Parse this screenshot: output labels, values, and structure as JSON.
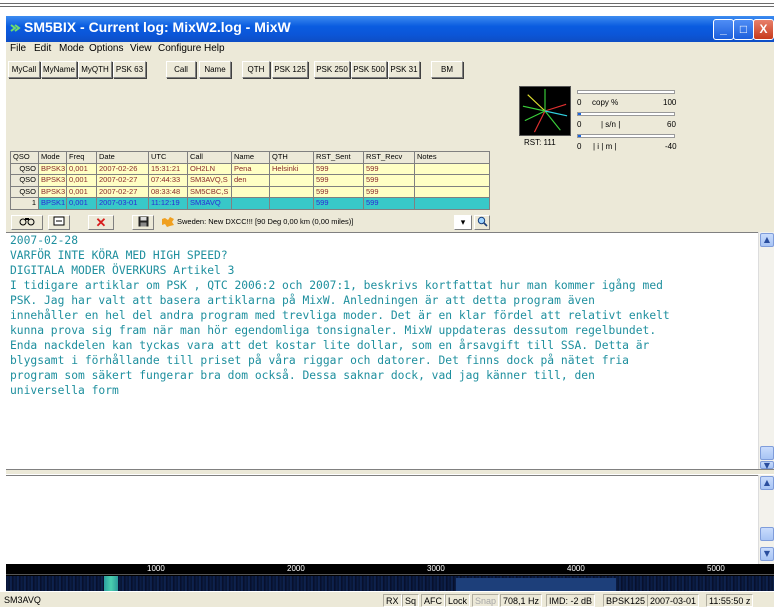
{
  "window": {
    "title": "SM5BIX - Current log: MixW2.log - MixW",
    "controls": [
      "_",
      "□",
      "X"
    ]
  },
  "menu": [
    "File",
    "Edit",
    "Mode",
    "Options",
    "View",
    "Configure",
    "Help"
  ],
  "macros": [
    "MyCall",
    "MyName",
    "MyQTH",
    "PSK 63",
    "Call",
    "Name",
    "QTH",
    "PSK 125",
    "PSK 250",
    "PSK 500",
    "PSK 31",
    "BM"
  ],
  "meters": {
    "copy": {
      "min": "0",
      "label": "copy %",
      "max": "100"
    },
    "sn": {
      "min": "0",
      "label": "| s/n |",
      "max": "60"
    },
    "imd": {
      "min": "0",
      "label": "| i | m |",
      "max": "-40"
    },
    "rst": "RST: 111"
  },
  "log": {
    "headers": [
      "QSO",
      "Mode",
      "Freq",
      "Date",
      "UTC",
      "Call",
      "Name",
      "QTH",
      "RST_Sent",
      "RST_Recv",
      "Notes"
    ],
    "rows": [
      [
        "QSO",
        "BPSK3",
        "0,001",
        "2007-02-26",
        "15:31:21",
        "OH2LN",
        "Pena",
        "Helsinki",
        "599",
        "599",
        ""
      ],
      [
        "QSO",
        "BPSK3",
        "0,001",
        "2007-02-27",
        "07:44:33",
        "SM3AVQ,S",
        "den",
        "",
        "599",
        "599",
        ""
      ],
      [
        "QSO",
        "BPSK3",
        "0,001",
        "2007-02-27",
        "08:33:48",
        "SM5CBC,S",
        "",
        "",
        "599",
        "599",
        ""
      ],
      [
        "1",
        "BPSK1",
        "0,001",
        "2007-03-01",
        "11:12:19",
        "SM3AVQ",
        "",
        "",
        "599",
        "599",
        ""
      ]
    ]
  },
  "toolbar": {
    "status": "Sweden:  New DXCC!!! [90 Deg  0,00 km (0,00 miles)]"
  },
  "rx_text": [
    "2007-02-28",
    "",
    "VARFÖR INTE KÖRA MED HIGH SPEED?",
    "",
    "DIGITALA MODER ÖVERKURS Artikel 3",
    "",
    "I tidigare artiklar om PSK , QTC 2006:2 och 2007:1, beskrivs kortfattat hur man kommer igång med",
    "PSK. Jag har valt att basera artiklarna på MixW. Anledningen är att detta program även",
    "innehåller en hel del andra program med trevliga moder. Det är en klar fördel att relativt enkelt",
    "kunna prova sig fram när man hör egendomliga tonsignaler. MixW uppdateras dessutom regelbundet.",
    "Enda nackdelen kan tyckas vara att det kostar lite dollar, som en årsavgift till SSA. Detta är",
    "blygsamt i förhållande till priset på våra riggar och datorer. Det finns dock på nätet fria",
    "program som säkert fungerar bra dom också. Dessa saknar dock, vad jag känner till, den",
    "universella form"
  ],
  "waterfall": {
    "ticks": [
      "1000",
      "2000",
      "3000",
      "4000",
      "5000"
    ]
  },
  "status": {
    "call": "SM3AVQ",
    "rx": "RX",
    "sq": "Sq",
    "afc": "AFC",
    "lock": "Lock",
    "snap": "Snap",
    "freq": "708,1 Hz",
    "imd": "IMD: -2 dB",
    "mode": "BPSK125",
    "date": "2007-03-01",
    "time": "11:55:50 z"
  },
  "colors": {
    "rx_text": "#1e8f9e",
    "log_row": "#ffffc4",
    "log_current_row": "#38c8c8",
    "titlebar": "#0b56d8"
  }
}
